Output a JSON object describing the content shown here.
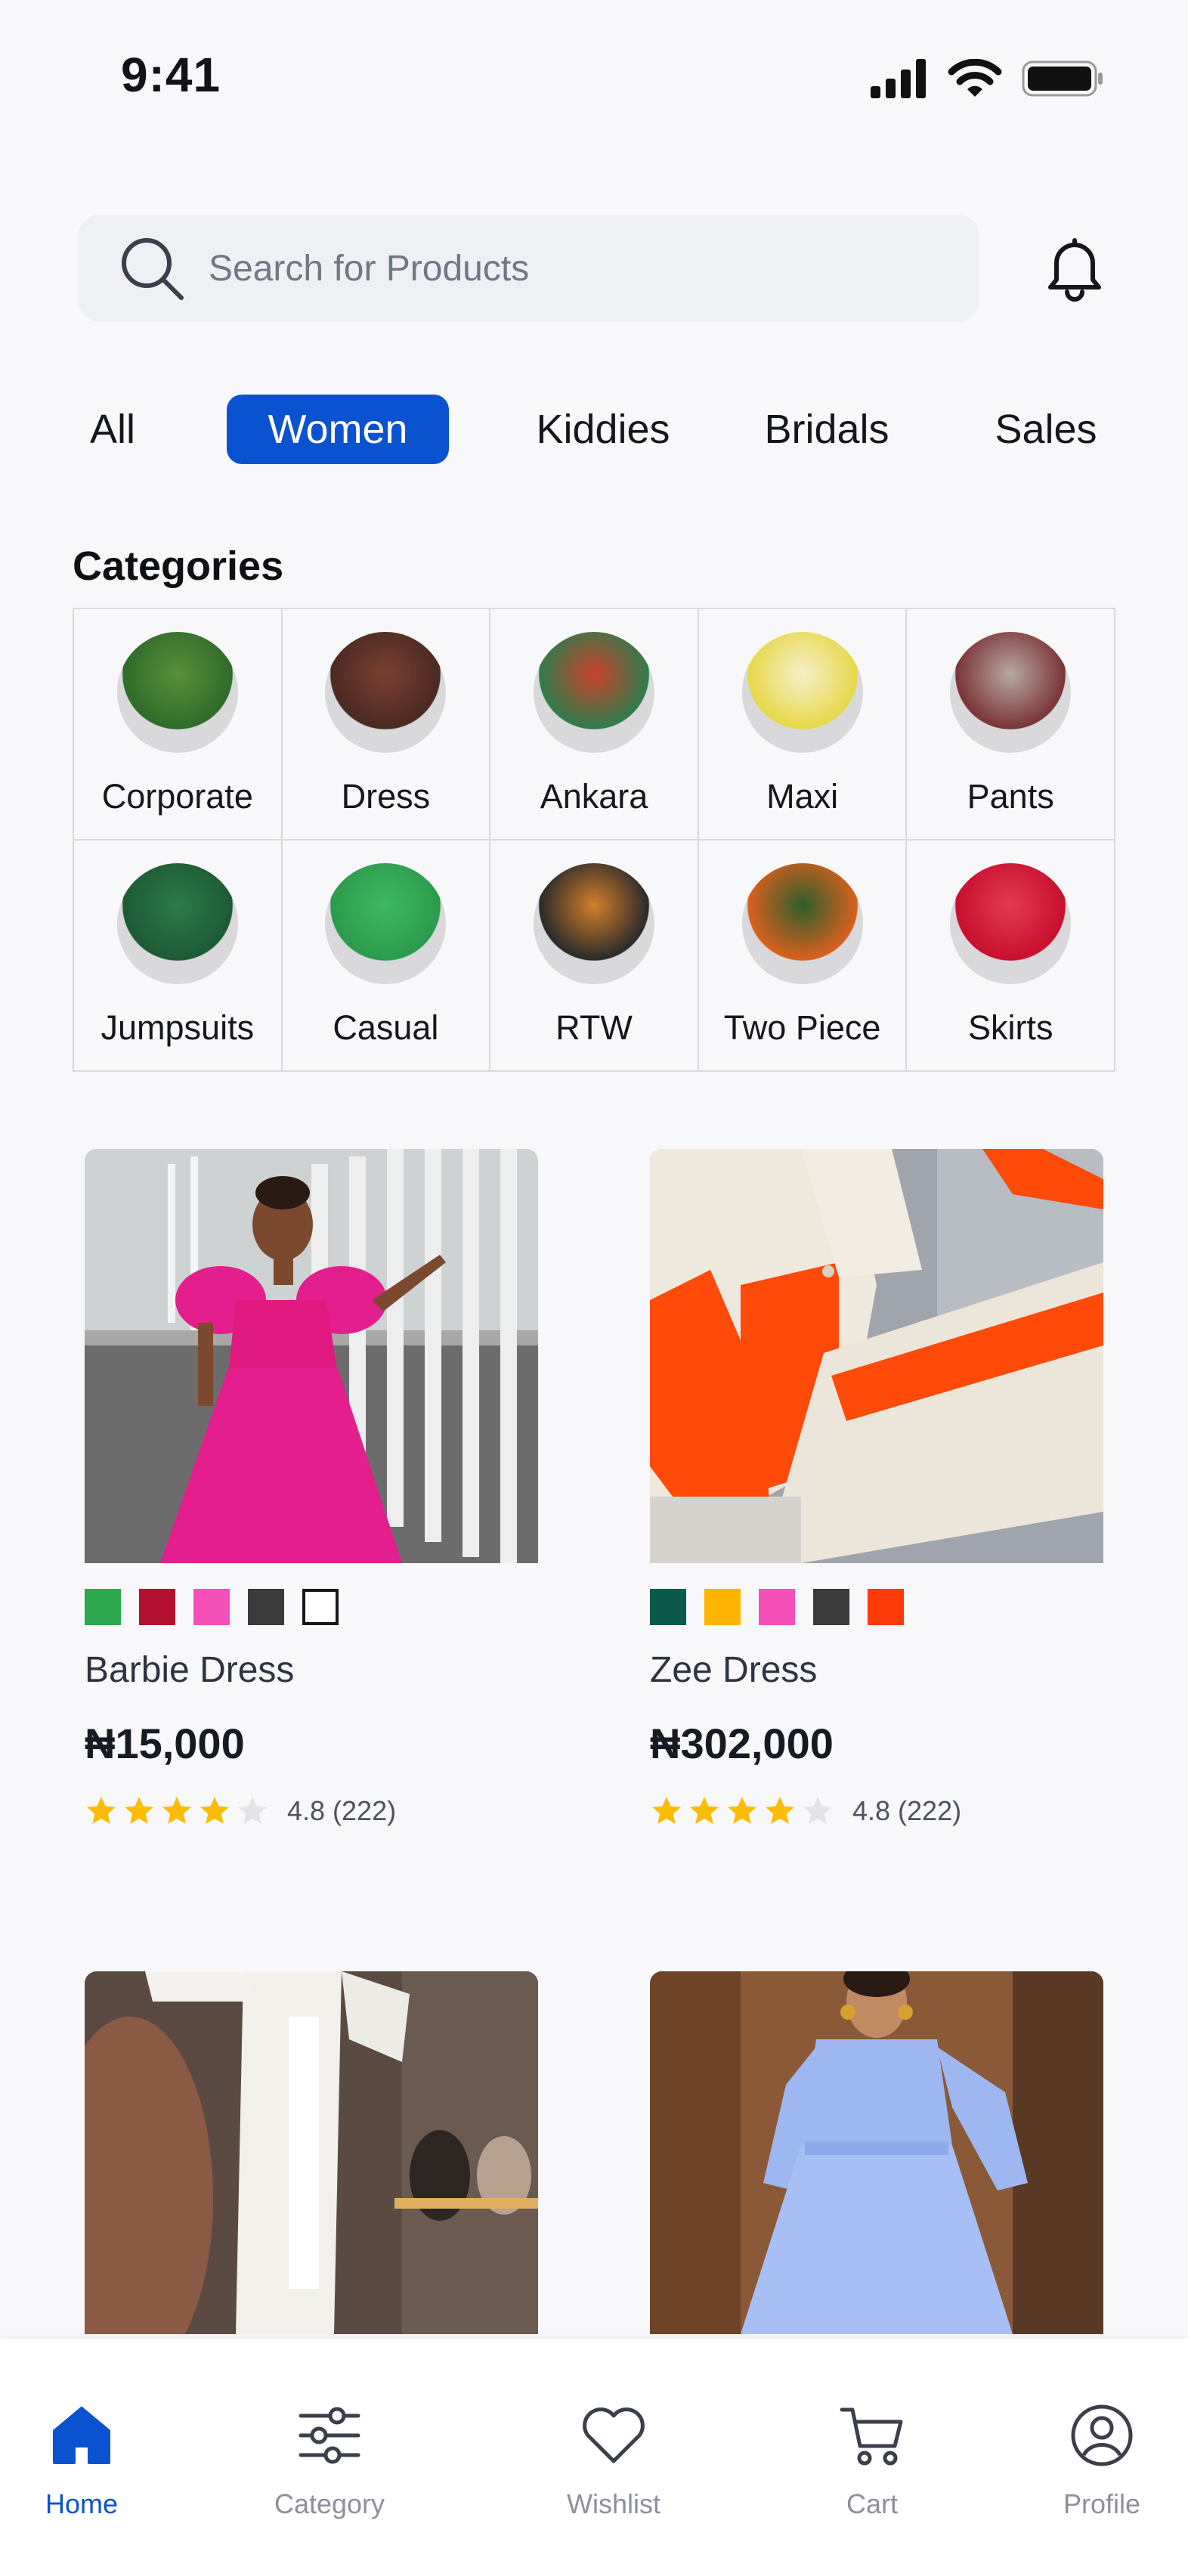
{
  "status_bar": {
    "time": "9:41"
  },
  "search": {
    "placeholder": "Search for Products"
  },
  "tabs": [
    {
      "label": "All"
    },
    {
      "label": "Women",
      "active": true
    },
    {
      "label": "Kiddies"
    },
    {
      "label": "Bridals"
    },
    {
      "label": "Sales"
    }
  ],
  "categories": {
    "title": "Categories",
    "items": [
      {
        "label": "Corporate",
        "colors": [
          "#2f6b2a",
          "#5a8f3a"
        ]
      },
      {
        "label": "Dress",
        "colors": [
          "#4a2a22",
          "#7a3f30"
        ]
      },
      {
        "label": "Ankara",
        "colors": [
          "#2e7d4b",
          "#c9402e"
        ]
      },
      {
        "label": "Maxi",
        "colors": [
          "#e8d84a",
          "#f4efc8"
        ]
      },
      {
        "label": "Pants",
        "colors": [
          "#7a3436",
          "#b8a9a1"
        ]
      },
      {
        "label": "Jumpsuits",
        "colors": [
          "#1d5a34",
          "#2d7a48"
        ]
      },
      {
        "label": "Casual",
        "colors": [
          "#2c9a4c",
          "#3fb862"
        ]
      },
      {
        "label": "RTW",
        "colors": [
          "#2a2a2a",
          "#d27f2b"
        ]
      },
      {
        "label": "Two Piece",
        "colors": [
          "#d9601c",
          "#2e5e2e"
        ]
      },
      {
        "label": "Skirts",
        "colors": [
          "#c8102e",
          "#e23a52"
        ]
      }
    ]
  },
  "products": [
    {
      "name": "Barbie Dress",
      "price": "₦15,000",
      "rating_text": "4.8 (222)",
      "stars_filled": 4,
      "swatches": [
        "#2ea84f",
        "#b2102f",
        "#f550b8",
        "#3a3a3a",
        "outline"
      ]
    },
    {
      "name": "Zee Dress",
      "price": "₦302,000",
      "rating_text": "4.8 (222)",
      "stars_filled": 4,
      "swatches": [
        "#0b5a4a",
        "#ffb400",
        "#f550b8",
        "#3a3a3a",
        "#ff3b0a"
      ]
    }
  ],
  "nav": [
    {
      "label": "Home",
      "icon": "home-icon",
      "active": true
    },
    {
      "label": "Category",
      "icon": "sliders-icon"
    },
    {
      "label": "Wishlist",
      "icon": "heart-icon"
    },
    {
      "label": "Cart",
      "icon": "cart-icon"
    },
    {
      "label": "Profile",
      "icon": "user-circle-icon"
    }
  ],
  "colors": {
    "accent": "#0b52d1",
    "star": "#fbbc05",
    "star_empty": "#e3e4e8"
  }
}
